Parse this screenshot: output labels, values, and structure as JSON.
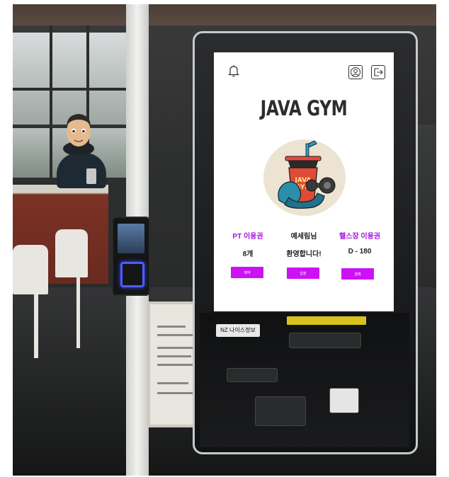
{
  "kiosk": {
    "title": "JAVA GYM",
    "logo_text_top": "JAVA",
    "logo_text_bottom": "GYM",
    "brand_strip": "NZ 나이스정보",
    "columns": [
      {
        "label": "PT 이용권",
        "value": "8개",
        "button": "예약"
      },
      {
        "label": "예세림님",
        "value": "환영합니다!",
        "button": "입장"
      },
      {
        "label": "헬스장 이용권",
        "value": "D - 180",
        "button": "결제"
      }
    ],
    "icons": {
      "notification": "bell-icon",
      "profile": "user-icon",
      "logout": "logout-icon"
    }
  },
  "colors": {
    "accent": "#cc11f5",
    "title": "#2d2d2d",
    "screen_bg": "#ffffff"
  }
}
